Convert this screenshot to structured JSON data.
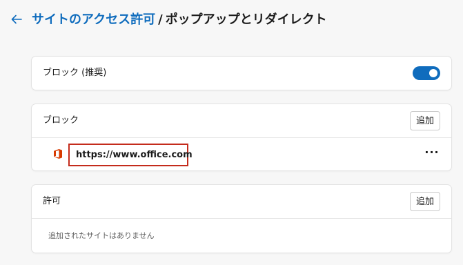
{
  "header": {
    "back_icon": "arrow-left-icon",
    "breadcrumb_parent": "サイトのアクセス許可",
    "separator": "/",
    "title": "ポップアップとリダイレクト"
  },
  "recommended": {
    "label": "ブロック (推奨)",
    "toggle_on": true,
    "accent_color": "#0f6cbd"
  },
  "block_section": {
    "title": "ブロック",
    "add_label": "追加",
    "sites": [
      {
        "icon": "office-logo-icon",
        "url": "https://www.office.com",
        "more_label": "···"
      }
    ]
  },
  "allow_section": {
    "title": "許可",
    "add_label": "追加",
    "empty_message": "追加されたサイトはありません"
  },
  "colors": {
    "link": "#0f6cbd",
    "highlight_border": "#c42b1c",
    "office_red": "#d83b01"
  }
}
